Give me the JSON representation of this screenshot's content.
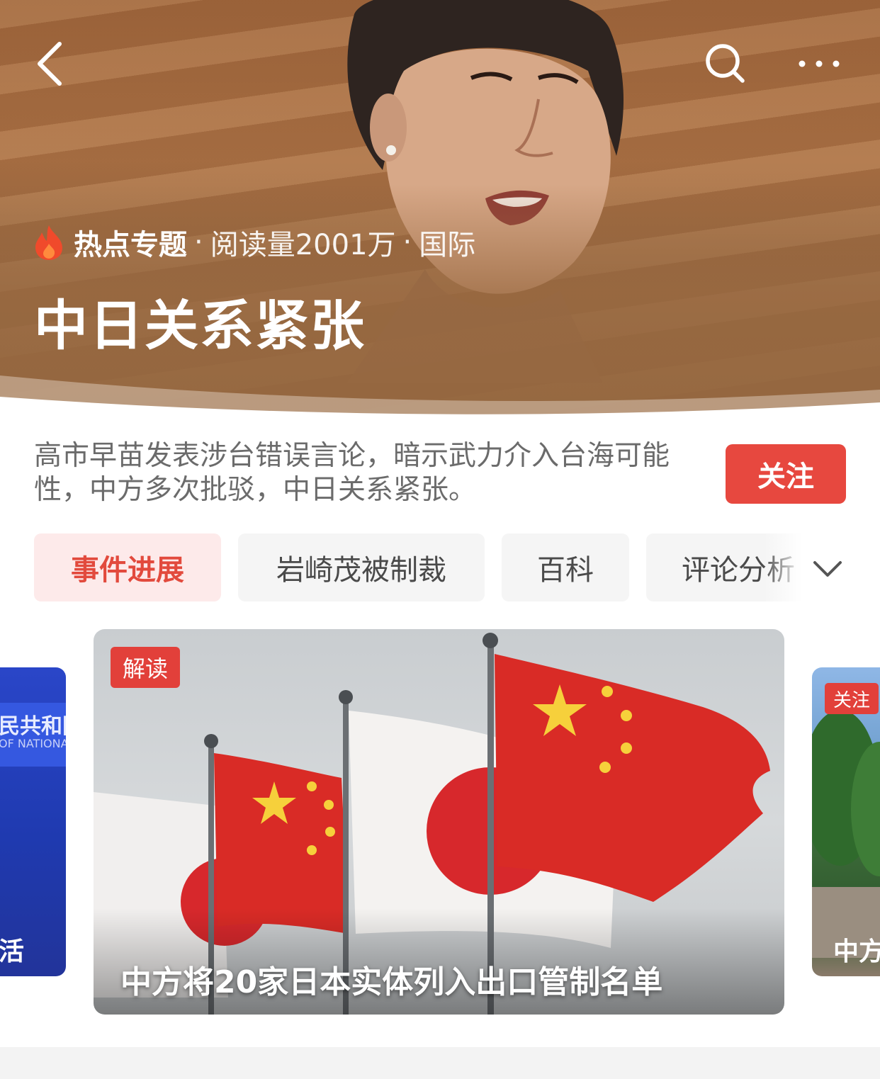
{
  "topic": {
    "category_tag": "热点专题",
    "read_count": "阅读量2001万",
    "section": "国际",
    "title": "中日关系紧张",
    "description": "高市早苗发表涉台错误言论，暗示武力介入台海可能性，中方多次批驳，中日关系紧张。",
    "follow_label": "关注"
  },
  "tabs": [
    {
      "label": "事件进展",
      "active": true
    },
    {
      "label": "岩崎茂被制裁",
      "active": false
    },
    {
      "label": "百科",
      "active": false
    },
    {
      "label": "评论分析",
      "active": false
    }
  ],
  "cards": {
    "left": {
      "title_fragment": "民共和国",
      "subtitle_fragment": "OF NATIONAL",
      "caption_fragment": "活"
    },
    "main": {
      "badge": "解读",
      "caption": "中方将20家日本实体列入出口管制名单"
    },
    "right": {
      "badge": "关注",
      "caption_fragment": "中方"
    }
  },
  "colors": {
    "accent": "#e7483f",
    "active_tab_bg": "#fdeaea",
    "hero_bg": "#a2683e"
  },
  "icons": {
    "back": "back-arrow-icon",
    "search": "search-icon",
    "more": "more-dots-icon",
    "hot": "fire-icon",
    "expand": "chevron-down-icon"
  }
}
